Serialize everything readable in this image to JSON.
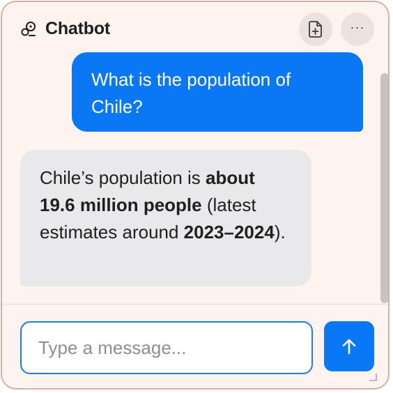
{
  "header": {
    "title": "Chatbot",
    "logo_icon": "chatbot-logo-icon",
    "attach_icon": "add-file-icon",
    "more_icon": "more-horizontal-icon",
    "more_label": "···"
  },
  "messages": [
    {
      "role": "user",
      "text": "What is the population of Chile?"
    },
    {
      "role": "assistant",
      "segments": [
        {
          "text": "Chile’s population is ",
          "bold": false
        },
        {
          "text": "about 19.6 million people",
          "bold": true
        },
        {
          "text": " (latest estimates around ",
          "bold": false
        },
        {
          "text": "2023–2024",
          "bold": true
        },
        {
          "text": ").",
          "bold": false
        }
      ]
    }
  ],
  "composer": {
    "placeholder": "Type a message...",
    "value": "",
    "send_icon": "arrow-up-icon"
  },
  "colors": {
    "accent": "#0a78f5",
    "window_bg": "#fdf3ef",
    "border": "#d9b1a2",
    "bot_bubble": "#e9e8ea"
  }
}
